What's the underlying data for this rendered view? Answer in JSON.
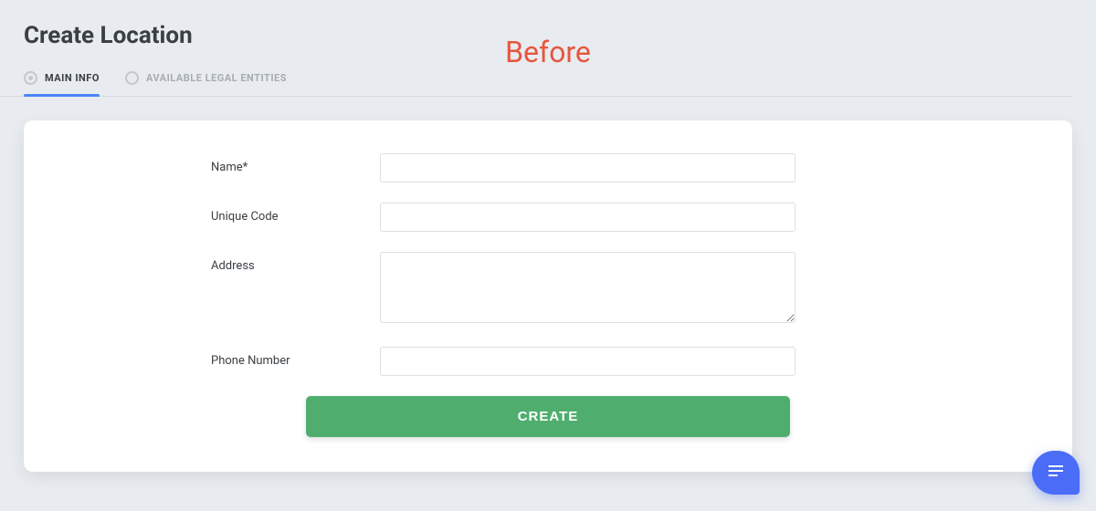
{
  "page": {
    "title": "Create Location",
    "before_label": "Before"
  },
  "tabs": [
    {
      "label": "MAIN INFO",
      "active": true
    },
    {
      "label": "AVAILABLE LEGAL ENTITIES",
      "active": false
    }
  ],
  "form": {
    "name": {
      "label": "Name*",
      "value": ""
    },
    "unique_code": {
      "label": "Unique Code",
      "value": ""
    },
    "address": {
      "label": "Address",
      "value": ""
    },
    "phone": {
      "label": "Phone Number",
      "value": ""
    }
  },
  "actions": {
    "create": "CREATE"
  },
  "chat_icon": "chat"
}
